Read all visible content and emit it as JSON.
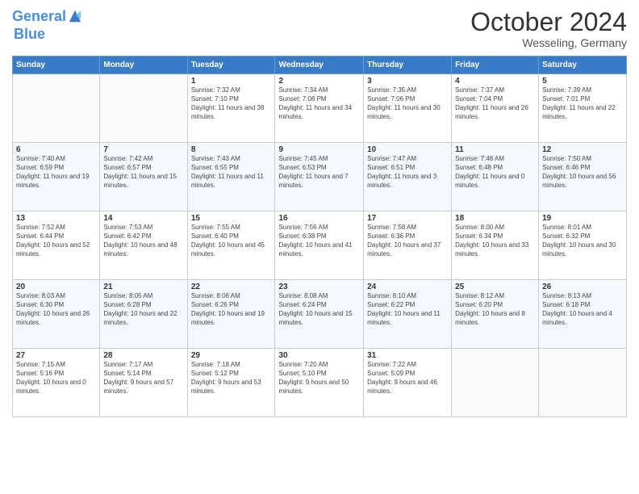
{
  "header": {
    "logo_line1": "General",
    "logo_line2": "Blue",
    "month": "October 2024",
    "location": "Wesseling, Germany"
  },
  "weekdays": [
    "Sunday",
    "Monday",
    "Tuesday",
    "Wednesday",
    "Thursday",
    "Friday",
    "Saturday"
  ],
  "weeks": [
    [
      {
        "day": "",
        "info": ""
      },
      {
        "day": "",
        "info": ""
      },
      {
        "day": "1",
        "info": "Sunrise: 7:32 AM\nSunset: 7:10 PM\nDaylight: 11 hours and 38 minutes."
      },
      {
        "day": "2",
        "info": "Sunrise: 7:34 AM\nSunset: 7:08 PM\nDaylight: 11 hours and 34 minutes."
      },
      {
        "day": "3",
        "info": "Sunrise: 7:35 AM\nSunset: 7:06 PM\nDaylight: 11 hours and 30 minutes."
      },
      {
        "day": "4",
        "info": "Sunrise: 7:37 AM\nSunset: 7:04 PM\nDaylight: 11 hours and 26 minutes."
      },
      {
        "day": "5",
        "info": "Sunrise: 7:39 AM\nSunset: 7:01 PM\nDaylight: 11 hours and 22 minutes."
      }
    ],
    [
      {
        "day": "6",
        "info": "Sunrise: 7:40 AM\nSunset: 6:59 PM\nDaylight: 11 hours and 19 minutes."
      },
      {
        "day": "7",
        "info": "Sunrise: 7:42 AM\nSunset: 6:57 PM\nDaylight: 11 hours and 15 minutes."
      },
      {
        "day": "8",
        "info": "Sunrise: 7:43 AM\nSunset: 6:55 PM\nDaylight: 11 hours and 11 minutes."
      },
      {
        "day": "9",
        "info": "Sunrise: 7:45 AM\nSunset: 6:53 PM\nDaylight: 11 hours and 7 minutes."
      },
      {
        "day": "10",
        "info": "Sunrise: 7:47 AM\nSunset: 6:51 PM\nDaylight: 11 hours and 3 minutes."
      },
      {
        "day": "11",
        "info": "Sunrise: 7:48 AM\nSunset: 6:48 PM\nDaylight: 11 hours and 0 minutes."
      },
      {
        "day": "12",
        "info": "Sunrise: 7:50 AM\nSunset: 6:46 PM\nDaylight: 10 hours and 56 minutes."
      }
    ],
    [
      {
        "day": "13",
        "info": "Sunrise: 7:52 AM\nSunset: 6:44 PM\nDaylight: 10 hours and 52 minutes."
      },
      {
        "day": "14",
        "info": "Sunrise: 7:53 AM\nSunset: 6:42 PM\nDaylight: 10 hours and 48 minutes."
      },
      {
        "day": "15",
        "info": "Sunrise: 7:55 AM\nSunset: 6:40 PM\nDaylight: 10 hours and 45 minutes."
      },
      {
        "day": "16",
        "info": "Sunrise: 7:56 AM\nSunset: 6:38 PM\nDaylight: 10 hours and 41 minutes."
      },
      {
        "day": "17",
        "info": "Sunrise: 7:58 AM\nSunset: 6:36 PM\nDaylight: 10 hours and 37 minutes."
      },
      {
        "day": "18",
        "info": "Sunrise: 8:00 AM\nSunset: 6:34 PM\nDaylight: 10 hours and 33 minutes."
      },
      {
        "day": "19",
        "info": "Sunrise: 8:01 AM\nSunset: 6:32 PM\nDaylight: 10 hours and 30 minutes."
      }
    ],
    [
      {
        "day": "20",
        "info": "Sunrise: 8:03 AM\nSunset: 6:30 PM\nDaylight: 10 hours and 26 minutes."
      },
      {
        "day": "21",
        "info": "Sunrise: 8:05 AM\nSunset: 6:28 PM\nDaylight: 10 hours and 22 minutes."
      },
      {
        "day": "22",
        "info": "Sunrise: 8:06 AM\nSunset: 6:26 PM\nDaylight: 10 hours and 19 minutes."
      },
      {
        "day": "23",
        "info": "Sunrise: 8:08 AM\nSunset: 6:24 PM\nDaylight: 10 hours and 15 minutes."
      },
      {
        "day": "24",
        "info": "Sunrise: 8:10 AM\nSunset: 6:22 PM\nDaylight: 10 hours and 11 minutes."
      },
      {
        "day": "25",
        "info": "Sunrise: 8:12 AM\nSunset: 6:20 PM\nDaylight: 10 hours and 8 minutes."
      },
      {
        "day": "26",
        "info": "Sunrise: 8:13 AM\nSunset: 6:18 PM\nDaylight: 10 hours and 4 minutes."
      }
    ],
    [
      {
        "day": "27",
        "info": "Sunrise: 7:15 AM\nSunset: 5:16 PM\nDaylight: 10 hours and 0 minutes."
      },
      {
        "day": "28",
        "info": "Sunrise: 7:17 AM\nSunset: 5:14 PM\nDaylight: 9 hours and 57 minutes."
      },
      {
        "day": "29",
        "info": "Sunrise: 7:18 AM\nSunset: 5:12 PM\nDaylight: 9 hours and 53 minutes."
      },
      {
        "day": "30",
        "info": "Sunrise: 7:20 AM\nSunset: 5:10 PM\nDaylight: 9 hours and 50 minutes."
      },
      {
        "day": "31",
        "info": "Sunrise: 7:22 AM\nSunset: 5:09 PM\nDaylight: 9 hours and 46 minutes."
      },
      {
        "day": "",
        "info": ""
      },
      {
        "day": "",
        "info": ""
      }
    ]
  ]
}
